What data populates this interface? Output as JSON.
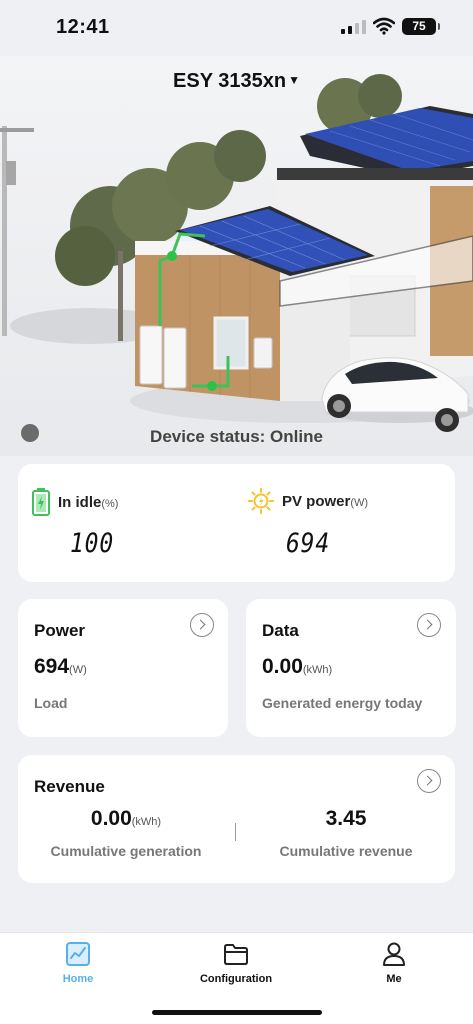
{
  "status_bar": {
    "time": "12:41",
    "battery": "75"
  },
  "header": {
    "device_name": "ESY 3135xn"
  },
  "device_status": "Device status: Online",
  "summary": {
    "idle": {
      "label": "In idle",
      "unit": "(%)",
      "value": "100"
    },
    "pv": {
      "label": "PV power",
      "unit": "(W)",
      "value": "694"
    }
  },
  "power_card": {
    "title": "Power",
    "value": "694",
    "unit": "(W)",
    "sub": "Load"
  },
  "data_card": {
    "title": "Data",
    "value": "0.00",
    "unit": "(kWh)",
    "sub": "Generated energy today"
  },
  "revenue_card": {
    "title": "Revenue",
    "generation": {
      "value": "0.00",
      "unit": "(kWh)",
      "label": "Cumulative generation"
    },
    "revenue": {
      "value": "3.45",
      "label": "Cumulative revenue"
    }
  },
  "tabs": [
    {
      "label": "Home",
      "active": true
    },
    {
      "label": "Configuration",
      "active": false
    },
    {
      "label": "Me",
      "active": false
    }
  ],
  "colors": {
    "accent": "#56b0ea",
    "battery_green": "#3ec15a",
    "sun_yellow": "#f4c430",
    "panel_blue": "#2f4fb5"
  }
}
